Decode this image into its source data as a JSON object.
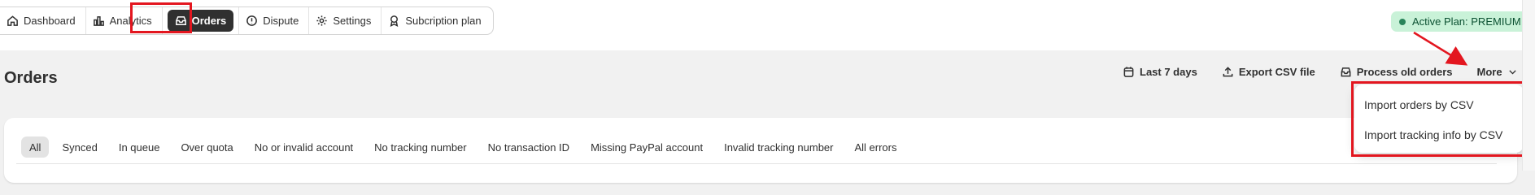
{
  "nav": {
    "items": [
      {
        "label": "Dashboard",
        "icon": "home-icon"
      },
      {
        "label": "Analytics",
        "icon": "bar-chart-icon"
      },
      {
        "label": "Orders",
        "icon": "inbox-icon",
        "active": true
      },
      {
        "label": "Dispute",
        "icon": "alert-circle-icon"
      },
      {
        "label": "Settings",
        "icon": "gear-icon"
      },
      {
        "label": "Subcription plan",
        "icon": "plan-icon"
      }
    ]
  },
  "plan_badge": {
    "label": "Active Plan: PREMIUM",
    "color": "#29845a"
  },
  "page": {
    "title": "Orders"
  },
  "actions": {
    "last_days": "Last 7 days",
    "export": "Export CSV file",
    "process_old": "Process old orders",
    "more": "More"
  },
  "dropdown": {
    "items": [
      "Import orders by CSV",
      "Import tracking info by CSV"
    ]
  },
  "filters": [
    "All",
    "Synced",
    "In queue",
    "Over quota",
    "No or invalid account",
    "No tracking number",
    "No transaction ID",
    "Missing PayPal account",
    "Invalid tracking number",
    "All errors"
  ],
  "colors": {
    "annotation": "#e3161f",
    "active_nav": "#303030",
    "badge_bg": "#c9f2d8"
  }
}
